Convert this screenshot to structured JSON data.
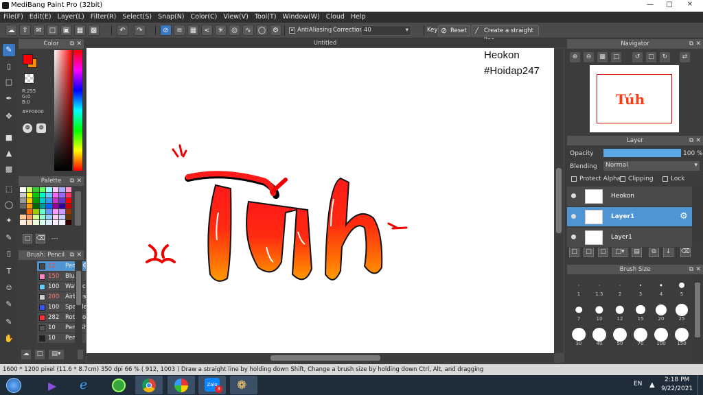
{
  "window": {
    "title": "MediBang Paint Pro (32bit)"
  },
  "menu": [
    "File(F)",
    "Edit(E)",
    "Layer(L)",
    "Filter(R)",
    "Select(S)",
    "Snap(N)",
    "Color(C)",
    "View(V)",
    "Tool(T)",
    "Window(W)",
    "Cloud",
    "Help"
  ],
  "toolbar": {
    "antialiasing_label": "AntiAliasing",
    "correction_label": "Correction",
    "correction_value": "40",
    "key_label": "Key",
    "reset_label": "Reset",
    "straight_line_label": "Create a straight line"
  },
  "color_panel": {
    "title": "Color",
    "r": "R:255",
    "g": "G:0",
    "b": "B:0",
    "hex": "#FF0000",
    "primary_color": "#ff0000",
    "secondary_color": "#ff8c00"
  },
  "palette_panel": {
    "title": "Palette",
    "more": "---",
    "swatches": [
      "#ffffff",
      "#ccff66",
      "#33cc33",
      "#66ff66",
      "#99ffff",
      "#ffccff",
      "#aaaaff",
      "#ff99cc",
      "#cccccc",
      "#ffff00",
      "#00cc00",
      "#00ffcc",
      "#66ccff",
      "#ff66ff",
      "#9966ff",
      "#ff3366",
      "#999999",
      "#ffcc00",
      "#009900",
      "#00cccc",
      "#3399ff",
      "#cc33cc",
      "#6633cc",
      "#ff0000",
      "#666666",
      "#ff9900",
      "#006600",
      "#009999",
      "#0066ff",
      "#990099",
      "#330099",
      "#cc0000",
      "#333333",
      "#ff6600",
      "#99cc00",
      "#66ffcc",
      "#6699ff",
      "#ff99ff",
      "#cc99ff",
      "#993300",
      "#ffcc99",
      "#ff9966",
      "#ccff99",
      "#99ffcc",
      "#99ccff",
      "#ffccee",
      "#ccccff",
      "#663300",
      "#ffeedd",
      "#ffddbb",
      "#eeffdd",
      "#ddffee",
      "#ddeeff",
      "#ffeeff",
      "#eeeeff",
      "#330000"
    ]
  },
  "brush_panel": {
    "title": "Brush: Pencil",
    "brushes": [
      {
        "size": "12",
        "name": "Pencil",
        "color": "#4a4a4a",
        "selected": true
      },
      {
        "size": "150",
        "name": "Blur",
        "color": "#ff88cc"
      },
      {
        "size": "100",
        "name": "Watercolor",
        "color": "#66ccff"
      },
      {
        "size": "200",
        "name": "Airbrush",
        "color": "#cccccc"
      },
      {
        "size": "100",
        "name": "Sparkle Brush",
        "color": "#3355ff"
      },
      {
        "size": "282",
        "name": "Rotation",
        "color": "#ff3333"
      },
      {
        "size": "10",
        "name": "Pen (Shading)",
        "color": "#555555"
      },
      {
        "size": "10",
        "name": "Pen",
        "color": "#222222"
      }
    ]
  },
  "canvas": {
    "doc_title": "Untitled",
    "watermark_name": "Heokon",
    "watermark_tag": "#Hoidap247",
    "art_text": "Tủh"
  },
  "navigator": {
    "title": "Navigator"
  },
  "layer_panel": {
    "title": "Layer",
    "opacity_label": "Opacity",
    "opacity_value": "100 %",
    "opacity_fraction": 1.0,
    "blending_label": "Blending",
    "blending_value": "Normal",
    "protect_alpha": "Protect Alpha",
    "clipping": "Clipping",
    "lock": "Lock",
    "layers": [
      {
        "name": "Heokon",
        "selected": false
      },
      {
        "name": "Layer1",
        "selected": true
      },
      {
        "name": "Layer1",
        "selected": false
      }
    ]
  },
  "brush_size_panel": {
    "title": "Brush Size",
    "sizes": [
      "1",
      "1.5",
      "2",
      "3",
      "4",
      "5",
      "7",
      "10",
      "12",
      "15",
      "20",
      "25",
      "30",
      "40",
      "50",
      "70",
      "100",
      "150"
    ]
  },
  "status": {
    "text": "1600 * 1200 pixel   (11.6 * 8.7cm)   350 dpi   66 %   ( 912, 1003 )   Draw a straight line by holding down Shift, Change a brush size by holding down Ctrl, Alt, and dragging"
  },
  "taskbar": {
    "lang": "EN",
    "time": "2:18 PM",
    "date": "9/22/2021",
    "zalo_badge": "3",
    "apps": [
      "start-orb-icon",
      "visual-studio-icon",
      "internet-explorer-icon",
      "coccoc-browser-icon",
      "chrome-icon",
      "photos-icon",
      "zalo-icon",
      "medibang-paint-icon"
    ]
  }
}
